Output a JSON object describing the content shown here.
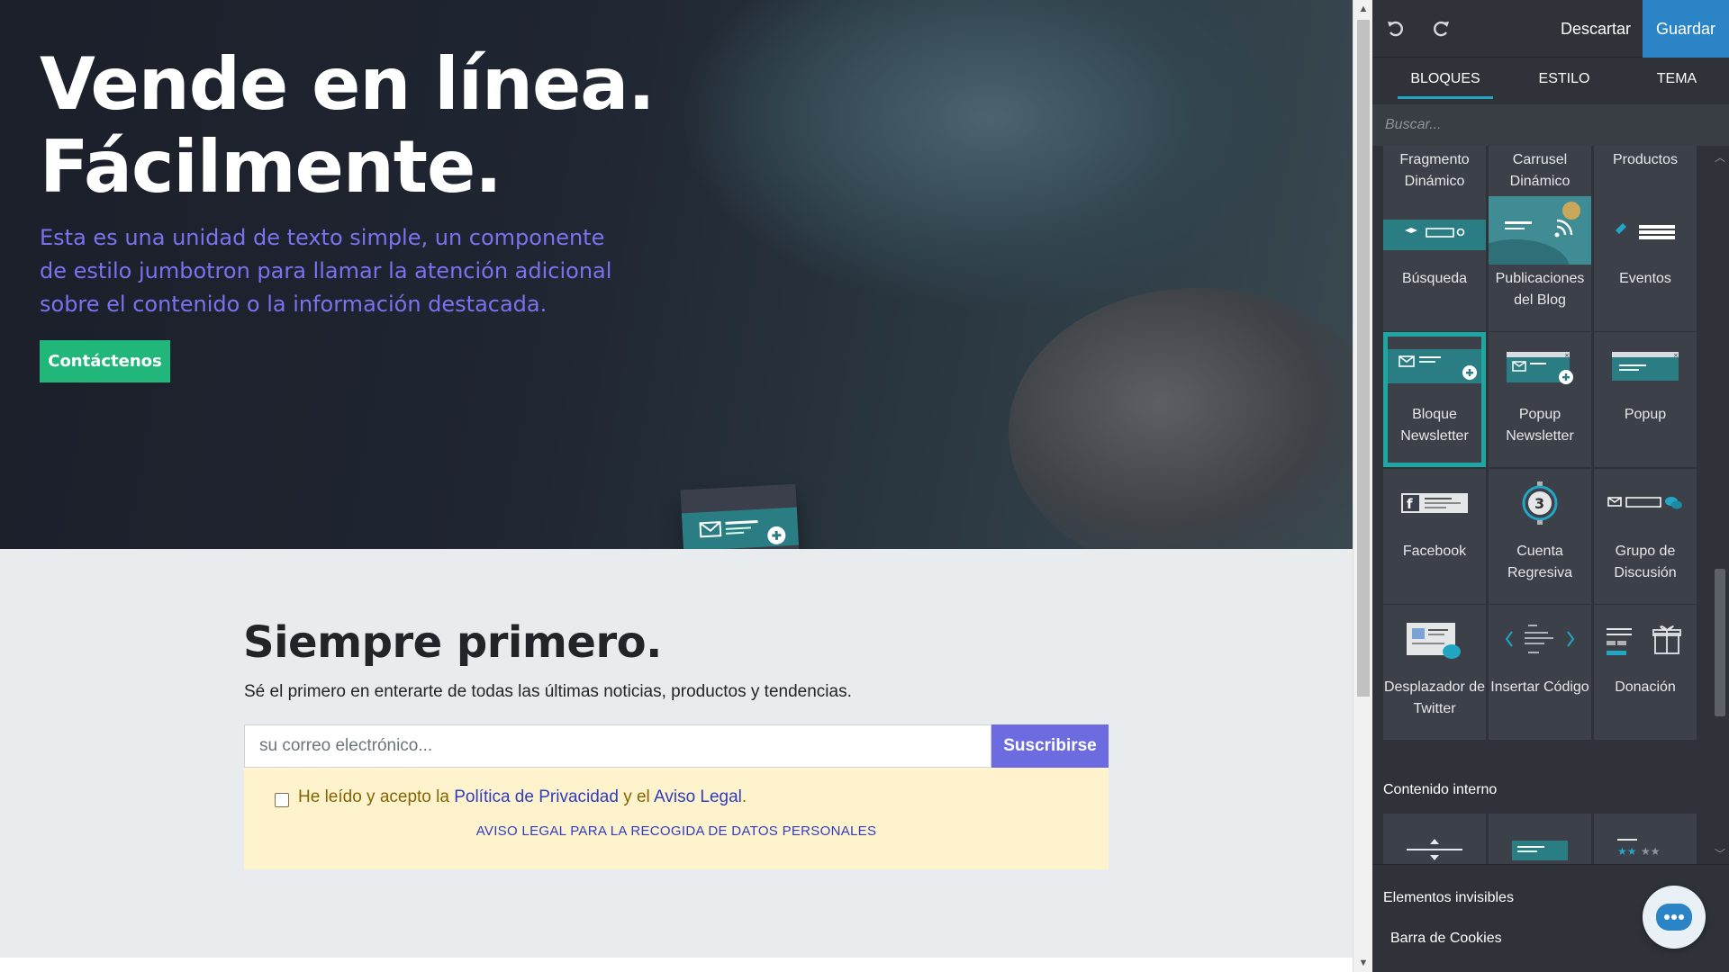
{
  "hero": {
    "title_line1": "Vende en línea.",
    "title_line2": "Fácilmente.",
    "text": "Esta es una unidad de texto simple, un componente de estilo jumbotron para llamar la atención adicional sobre el contenido o la información destacada.",
    "button": "Contáctenos"
  },
  "newsletter": {
    "title": "Siempre primero.",
    "subtitle": "Sé el primero en enterarte de todas las últimas noticias, productos y tendencias.",
    "email_placeholder": "su correo electrónico...",
    "submit": "Suscribirse",
    "consent_prefix": "He leído y acepto la ",
    "privacy_link": "Política de Privacidad",
    "consent_mid": " y el ",
    "legal_link": "Aviso Legal",
    "consent_suffix": ".",
    "legal_notice": "AVISO LEGAL PARA LA RECOGIDA DE DATOS PERSONALES"
  },
  "editor": {
    "undo_icon": "undo-icon",
    "redo_icon": "redo-icon",
    "discard": "Descartar",
    "save": "Guardar",
    "tabs": [
      "BLOQUES",
      "ESTILO",
      "TEMA"
    ],
    "active_tab": "BLOQUES",
    "search_placeholder": "Buscar...",
    "blocks_partial": [
      "Fragmento Dinámico",
      "Carrusel Dinámico",
      "Productos"
    ],
    "blocks": [
      "Búsqueda",
      "Publicaciones del Blog",
      "Eventos",
      "Bloque Newsletter",
      "Popup Newsletter",
      "Popup",
      "Facebook",
      "Cuenta Regresiva",
      "Grupo de Discusión",
      "Desplazador de Twitter",
      "Insertar Código",
      "Donación"
    ],
    "selected_block": "Bloque Newsletter",
    "section_inner": "Contenido interno",
    "section_invisible": "Elementos invisibles",
    "invisible_items": [
      "Barra de Cookies"
    ],
    "countdown_number": "3",
    "accent_color": "#1fa6a3",
    "save_color": "#2b84c6"
  }
}
